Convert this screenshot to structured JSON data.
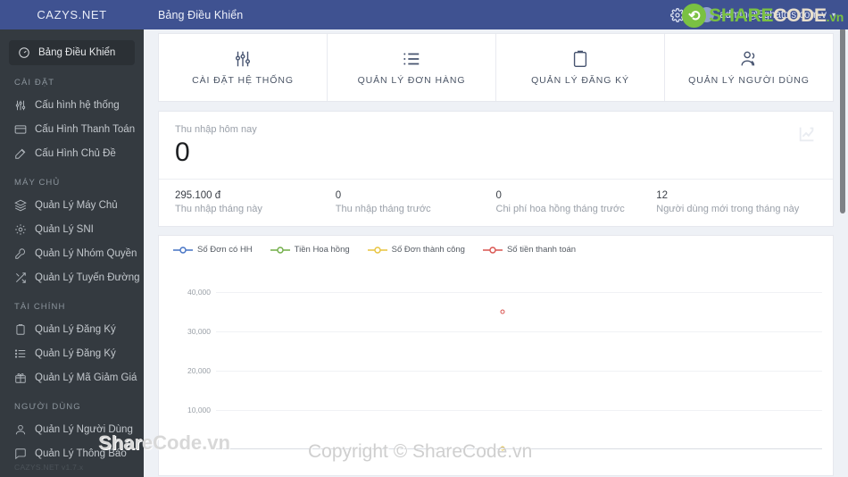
{
  "brand": {
    "name": "CAZYS.NET",
    "version": "CAZYS.NET v1.7.x"
  },
  "topbar": {
    "title": "Bảng Điều Khiển",
    "gear_icon": "gear-icon",
    "user_email": "admin@5ghatcls.com.v",
    "caret": "▾"
  },
  "sidebar": {
    "active_item": {
      "label": "Bảng Điều Khiển",
      "icon": "dashboard-gauge-icon"
    },
    "sections": [
      {
        "title": "CÀI ĐẶT",
        "items": [
          {
            "label": "Cấu hình hệ thống",
            "icon": "sliders-icon"
          },
          {
            "label": "Cấu Hình Thanh Toán",
            "icon": "credit-card-icon"
          },
          {
            "label": "Cấu Hình Chủ Đề",
            "icon": "magic-wand-icon"
          }
        ]
      },
      {
        "title": "MÁY CHỦ",
        "items": [
          {
            "label": "Quản Lý Máy Chủ",
            "icon": "server-stack-icon"
          },
          {
            "label": "Quản Lý SNI",
            "icon": "cog-icon"
          },
          {
            "label": "Quản Lý Nhóm Quyền",
            "icon": "wrench-icon"
          },
          {
            "label": "Quản Lý Tuyến Đường",
            "icon": "shuffle-icon"
          }
        ]
      },
      {
        "title": "TÀI CHÍNH",
        "items": [
          {
            "label": "Quản Lý Đăng Ký",
            "icon": "clipboard-icon"
          },
          {
            "label": "Quản Lý Đăng Ký",
            "icon": "list-icon"
          },
          {
            "label": "Quản Lý Mã Giảm Giá",
            "icon": "gift-icon"
          }
        ]
      },
      {
        "title": "NGƯỜI DÙNG",
        "items": [
          {
            "label": "Quản Lý Người Dùng",
            "icon": "user-icon"
          },
          {
            "label": "Quản Lý Thông Báo",
            "icon": "chat-icon"
          }
        ]
      }
    ]
  },
  "quick_actions": [
    {
      "label": "CÀI ĐẶT HỆ THỐNG",
      "icon": "sliders-icon"
    },
    {
      "label": "QUẢN LÝ ĐƠN HÀNG",
      "icon": "list-icon"
    },
    {
      "label": "QUẢN LÝ ĐĂNG KÝ",
      "icon": "clipboard-icon"
    },
    {
      "label": "QUẢN LÝ NGƯỜI DÙNG",
      "icon": "users-icon"
    }
  ],
  "income": {
    "label": "Thu nhập hôm nay",
    "value": "0",
    "corner_icon": "line-chart-icon"
  },
  "stats": [
    {
      "value": "295.100 đ",
      "caption": "Thu nhập tháng này"
    },
    {
      "value": "0",
      "caption": "Thu nhập tháng trước"
    },
    {
      "value": "0",
      "caption": "Chi phí hoa hồng tháng trước"
    },
    {
      "value": "12",
      "caption": "Người dùng mới trong tháng này"
    }
  ],
  "chart_data": {
    "type": "line",
    "title": "",
    "xlabel": "",
    "ylabel": "",
    "ylim": [
      0,
      44000
    ],
    "yticks": [
      10000,
      20000,
      30000,
      40000
    ],
    "ytick_labels": [
      "10,000",
      "20,000",
      "30,000",
      "40,000"
    ],
    "grid": true,
    "legend_position": "top-left",
    "x": [
      ""
    ],
    "series": [
      {
        "name": "Số Đơn có HH",
        "color": "#4472c4",
        "values": [
          0
        ]
      },
      {
        "name": "Tiền Hoa hồng",
        "color": "#70ad47",
        "values": [
          0
        ]
      },
      {
        "name": "Số Đơn thành công",
        "color": "#e8c33d",
        "values": [
          0
        ]
      },
      {
        "name": "Số tiền thanh toán",
        "color": "#d9534f",
        "values": [
          35500
        ]
      }
    ],
    "points": [
      {
        "series": "Số tiền thanh toán",
        "color": "#d9534f",
        "x_pct": 51,
        "value": 35500
      },
      {
        "series": "Số Đơn thành công",
        "color": "#e8c33d",
        "x_pct": 51,
        "value": 0
      }
    ]
  },
  "watermarks": {
    "logo_share": "SHARE",
    "logo_code": "CODE",
    "logo_vn": ".vn",
    "small": "ShareCode.vn",
    "copyright": "Copyright © ShareCode.vn"
  }
}
